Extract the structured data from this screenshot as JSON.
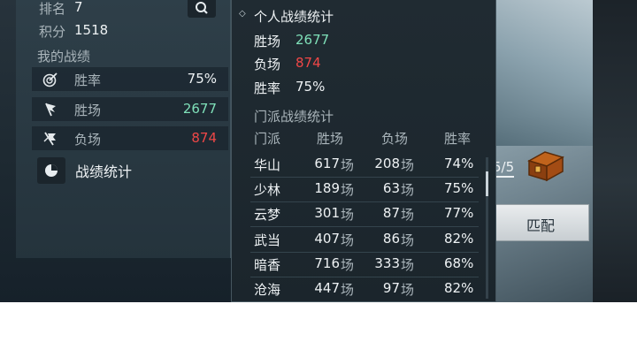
{
  "left": {
    "rank_label": "排名",
    "rank_value": "7",
    "points_label": "积分",
    "points_value": "1518",
    "my_record": "我的战绩",
    "rows": [
      {
        "label": "胜率",
        "value": "75%",
        "icon": "target-icon"
      },
      {
        "label": "胜场",
        "value": "2677",
        "icon": "flag-icon"
      },
      {
        "label": "负场",
        "value": "874",
        "icon": "broken-flag-icon"
      }
    ],
    "stats_button": "战绩统计"
  },
  "popup": {
    "personal_title": "个人战绩统计",
    "personal": [
      {
        "label": "胜场",
        "value": "2677"
      },
      {
        "label": "负场",
        "value": "874"
      },
      {
        "label": "胜率",
        "value": "75%"
      }
    ],
    "sect_title": "门派战绩统计",
    "headers": [
      "门派",
      "胜场",
      "负场",
      "胜率"
    ],
    "unit": "场",
    "sects": [
      {
        "name": "华山",
        "wins": "617",
        "losses": "208",
        "rate": "74%"
      },
      {
        "name": "少林",
        "wins": "189",
        "losses": "63",
        "rate": "75%"
      },
      {
        "name": "云梦",
        "wins": "301",
        "losses": "87",
        "rate": "77%"
      },
      {
        "name": "武当",
        "wins": "407",
        "losses": "86",
        "rate": "82%"
      },
      {
        "name": "暗香",
        "wins": "716",
        "losses": "333",
        "rate": "68%"
      },
      {
        "name": "沧海",
        "wins": "447",
        "losses": "97",
        "rate": "82%"
      }
    ]
  },
  "right": {
    "counter": "5/5",
    "match_button": "匹配"
  },
  "colors": {
    "win": "#7fe0b9",
    "loss": "#ef4747"
  }
}
